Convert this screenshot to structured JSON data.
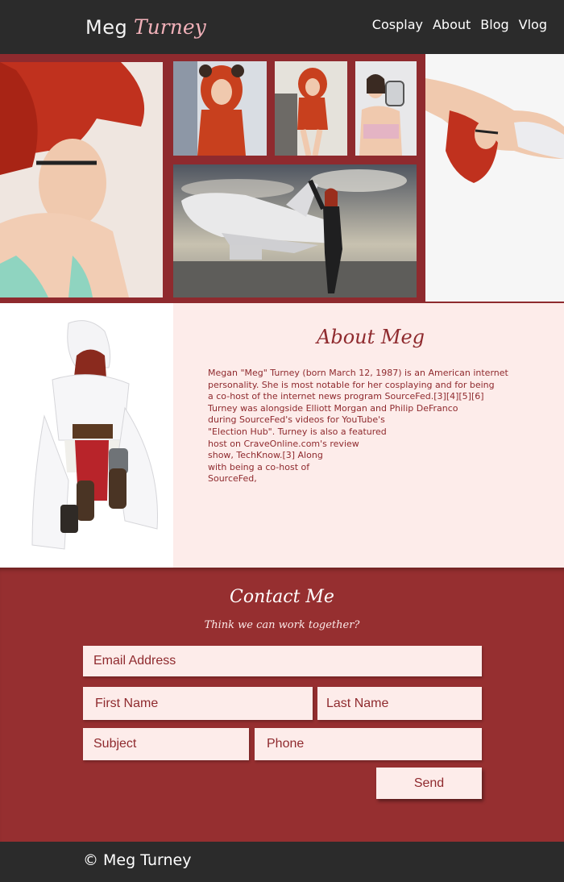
{
  "header": {
    "logo_first": "Meg",
    "logo_last": "Turney",
    "nav": [
      {
        "label": "Cosplay"
      },
      {
        "label": "About"
      },
      {
        "label": "Blog"
      },
      {
        "label": "Vlog"
      }
    ]
  },
  "about": {
    "title": "About Meg",
    "lines": [
      "Megan \"Meg\" Turney (born March 12, 1987) is an American internet",
      "personality. She is most notable for her cosplaying and for being",
      "a co-host of the internet news program SourceFed.[3][4][5][6]",
      "Turney was alongside Elliott Morgan and Philip DeFranco",
      "during SourceFed's videos for YouTube's",
      "\"Election Hub\". Turney is also a featured",
      "host on CraveOnline.com's review",
      "show, TechKnow.[3] Along",
      "with being a co-host of",
      "SourceFed,"
    ]
  },
  "contact": {
    "title": "Contact Me",
    "subtitle": "Think we can work together?",
    "email_placeholder": "Email Address",
    "first_name_placeholder": "First Name",
    "last_name_placeholder": "Last Name",
    "subject_placeholder": "Subject",
    "phone_placeholder": "Phone",
    "send_label": "Send"
  },
  "footer": {
    "copyright": "© Meg Turney"
  },
  "colors": {
    "header_bg": "#2b2b2b",
    "accent": "#962f30",
    "light_pink": "#fdecea",
    "logo_pink": "#f0b0b8"
  }
}
